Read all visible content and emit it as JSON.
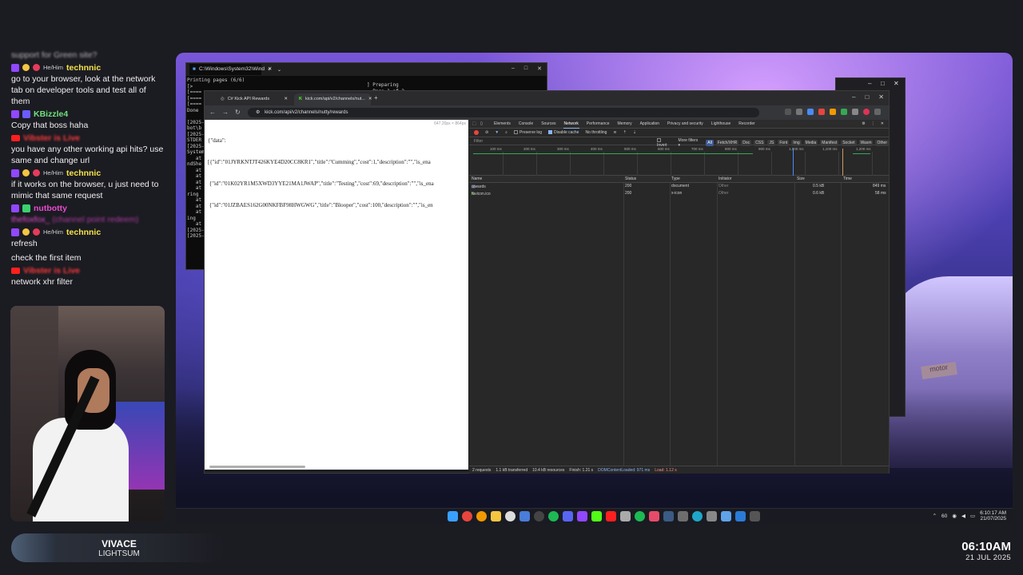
{
  "chat": {
    "top_fragment": "support for Green site?",
    "messages": [
      {
        "kind": "user",
        "pronouns": "He/Him",
        "user": "technnic",
        "user_color": "#f5e44a",
        "text": "go to your browser, look at the network tab on developer tools and test all of them"
      },
      {
        "kind": "user",
        "pronouns": "",
        "user": "KBizzle4",
        "user_color": "#6ee07a",
        "text": "Copy that boss haha"
      },
      {
        "kind": "youtube",
        "user": "Vibster is Live",
        "user_color": "#ff3b3b",
        "text": "you have any other working api hits? use same and change url"
      },
      {
        "kind": "user",
        "pronouns": "He/Him",
        "user": "technnic",
        "user_color": "#f5e44a",
        "text": "if it works on the browser, u just need to mimic that same request"
      },
      {
        "kind": "user",
        "pronouns": "",
        "user": "nutbotty",
        "user_color": "#e84bd0",
        "text": ""
      },
      {
        "kind": "redeem",
        "user": "thefoxfox_",
        "user_color": "#e84bd0",
        "text": "(channel point redeem)"
      },
      {
        "kind": "user",
        "pronouns": "He/Him",
        "user": "technnic",
        "user_color": "#f5e44a",
        "text": "refresh"
      },
      {
        "kind": "plain",
        "text": "check the first item"
      },
      {
        "kind": "youtube",
        "user": "Vibster is Live",
        "user_color": "#ff3b3b",
        "text": "network xhr filter"
      }
    ]
  },
  "now_playing": {
    "title": "VIVACE",
    "artist": "LIGHTSUM"
  },
  "clock": {
    "time": "06:10AM",
    "date": "21 JUL 2025"
  },
  "console": {
    "tab_title": "C:\\Windows\\System32\\Wind",
    "output": "Printing pages (6/6)\n[>\n[====\n[====\n[====\nDone\n\n[2025-\nbot\\b\n[2025-\nSTDER\n[2025-\nSystem\n   at\nndShe\n   at\n   at\n   at\n   at\nring\n   at\n   at\n   at\ning\n   at\n[2025-\n[2025-",
    "right_output": "] Preparing\n  Page 1 of 2"
  },
  "chrome": {
    "tabs": [
      {
        "title": "C# Kick API Rewards"
      },
      {
        "title": "kick.com/api/v2/channels/nut..."
      }
    ],
    "url": "kick.com/api/v2/channels/nutty/rewards",
    "viewport_dims": "647.20px × 864px",
    "json_lines": [
      "{\"data\":",
      "[{\"id\":\"01JYRKNTJT426KYE4D20CC8KR1\",\"title\":\"Cumming\",\"cost\":1,\"description\":\"\",\"is_ena",
      " {\"id\":\"01K02YR1M5XWD3YYE21MA1JWAP\",\"title\":\"Testing\",\"cost\":69,\"description\":\"\",\"is_ena",
      " {\"id\":\"01JZBAES162G00NKFBF98HWGWG\",\"title\":\"Blooper\",\"cost\":100,\"description\":\"\",\"is_en"
    ]
  },
  "devtools": {
    "tabs": [
      "Elements",
      "Console",
      "Sources",
      "Network",
      "Performance",
      "Memory",
      "Application",
      "Privacy and security",
      "Lighthouse",
      "Recorder"
    ],
    "active_tab": "Network",
    "toolbar": {
      "preserve_log": "Preserve log",
      "disable_cache": "Disable cache",
      "throttling": "No throttling"
    },
    "filter_placeholder": "Filter",
    "invert": "Invert",
    "more_filters": "More filters ▾",
    "filter_types": [
      "All",
      "Fetch/XHR",
      "Doc",
      "CSS",
      "JS",
      "Font",
      "Img",
      "Media",
      "Manifest",
      "Socket",
      "Wasm",
      "Other"
    ],
    "active_filter": "All",
    "timeline_ticks": [
      "100 ms",
      "200 ms",
      "300 ms",
      "400 ms",
      "500 ms",
      "600 ms",
      "700 ms",
      "800 ms",
      "900 ms",
      "1,000 ms",
      "1,100 ms",
      "1,200 ms"
    ],
    "columns": {
      "name": "Name",
      "status": "Status",
      "type": "Type",
      "initiator": "Initiator",
      "size": "Size",
      "time": "Time"
    },
    "requests": [
      {
        "name": "rewards",
        "status": "200",
        "type": "document",
        "initiator": "Other",
        "size": "0.5 kB",
        "time": "849 ms"
      },
      {
        "name": "favicon.ico",
        "status": "200",
        "type": "x-icon",
        "initiator": "Other",
        "size": "0.6 kB",
        "time": "58 ms"
      }
    ],
    "status": {
      "requests": "2 requests",
      "transferred": "1.1 kB transferred",
      "resources": "10.4 kB resources",
      "finish": "Finish: 1.21 s",
      "dom": "DOMContentLoaded: 971 ms",
      "load": "Load: 1.12 s"
    }
  },
  "taskbar": {
    "tray_text": "60",
    "clock_time": "6:10:17 AM",
    "clock_date": "21/07/2025"
  },
  "desktop": {
    "sign_text": "motor"
  },
  "colors": {
    "accent": "#8ab4f8",
    "record": "#e8453c",
    "chat_bg": "#1b1b22"
  }
}
